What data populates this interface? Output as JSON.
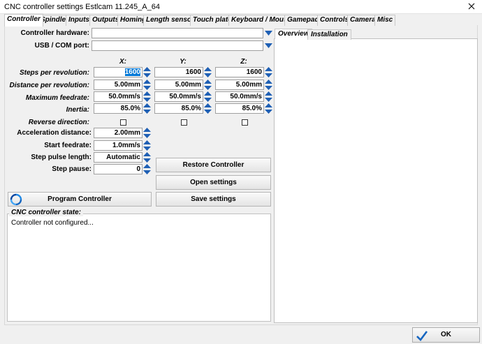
{
  "window": {
    "title": "CNC controller settings Estlcam 11.245_A_64"
  },
  "tabs": [
    "Controller",
    "Spindle",
    "Inputs",
    "Outputs",
    "Homing",
    "Length sensor",
    "Touch plate",
    "Keyboard / Mouse",
    "Gamepad",
    "Controls",
    "Camera",
    "Misc"
  ],
  "form": {
    "controller_hardware_label": "Controller hardware:",
    "controller_hardware_value": "",
    "usb_port_label": "USB / COM port:",
    "usb_port_value": "",
    "axes": [
      "X:",
      "Y:",
      "Z:"
    ],
    "rows": [
      {
        "label": "Steps per revolution:",
        "values": [
          "1600",
          "1600",
          "1600"
        ]
      },
      {
        "label": "Distance per revolution:",
        "values": [
          "5.00mm",
          "5.00mm",
          "5.00mm"
        ]
      },
      {
        "label": "Maximum feedrate:",
        "values": [
          "50.0mm/s",
          "50.0mm/s",
          "50.0mm/s"
        ]
      },
      {
        "label": "Inertia:",
        "values": [
          "85.0%",
          "85.0%",
          "85.0%"
        ]
      }
    ],
    "reverse_direction_label": "Reverse direction:",
    "reverse_direction": [
      false,
      false,
      false
    ],
    "acceleration_distance_label": "Acceleration distance:",
    "acceleration_distance": "2.00mm",
    "start_feedrate_label": "Start feedrate:",
    "start_feedrate": "1.0mm/s",
    "step_pulse_length_label": "Step pulse length:",
    "step_pulse_length": "Automatic",
    "step_pause_label": "Step pause:",
    "step_pause": "0"
  },
  "buttons": {
    "restore": "Restore Controller",
    "open": "Open settings",
    "program": "Program Controller",
    "save": "Save settings",
    "ok": "OK"
  },
  "state": {
    "title": "CNC controller state:",
    "text": "Controller  not  configured..."
  },
  "side_tabs": [
    "Overview",
    "Installation"
  ],
  "colors": {
    "accent": "#0078d7",
    "selection": "#0078d7"
  },
  "icons": [
    "close-icon",
    "dropdown-arrow-icon",
    "spin-up-down-icon",
    "program-refresh-icon",
    "checkmark-icon"
  ]
}
